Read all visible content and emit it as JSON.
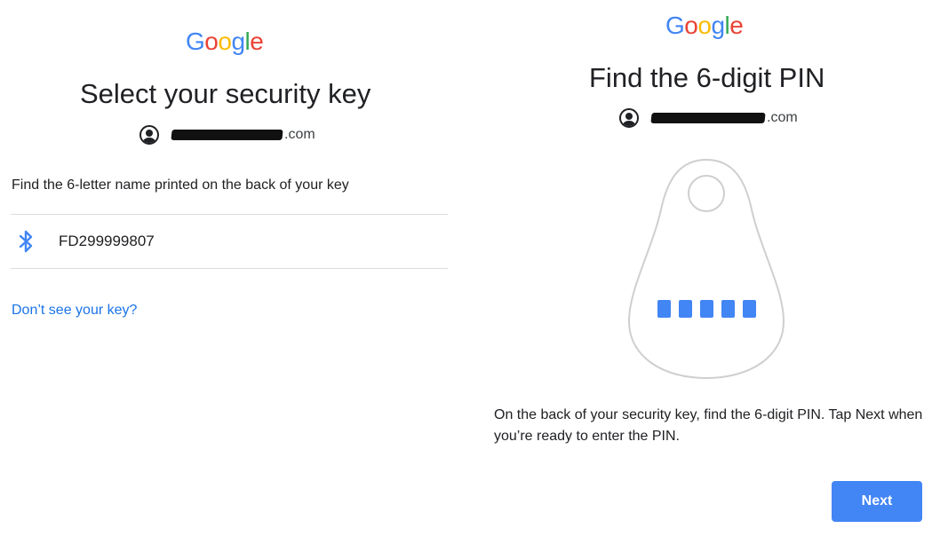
{
  "left": {
    "logo": [
      "G",
      "o",
      "o",
      "g",
      "l",
      "e"
    ],
    "title": "Select your security key",
    "account_suffix": ".com",
    "instruction": "Find the 6-letter name printed on the back of your key",
    "device": {
      "icon": "bluetooth-icon",
      "name": "FD299999807"
    },
    "help_link": "Don’t see your key?"
  },
  "right": {
    "logo": [
      "G",
      "o",
      "o",
      "g",
      "l",
      "e"
    ],
    "title": "Find the 6-digit PIN",
    "account_suffix": ".com",
    "illustration": {
      "icon": "security-key-icon",
      "pin_dots": 5
    },
    "body": "On the back of your security key, find the 6-digit PIN. Tap Next when you’re ready to enter the PIN.",
    "next_label": "Next"
  },
  "colors": {
    "accent": "#4285F4",
    "link": "#1a73e8",
    "divider": "#dadce0"
  }
}
